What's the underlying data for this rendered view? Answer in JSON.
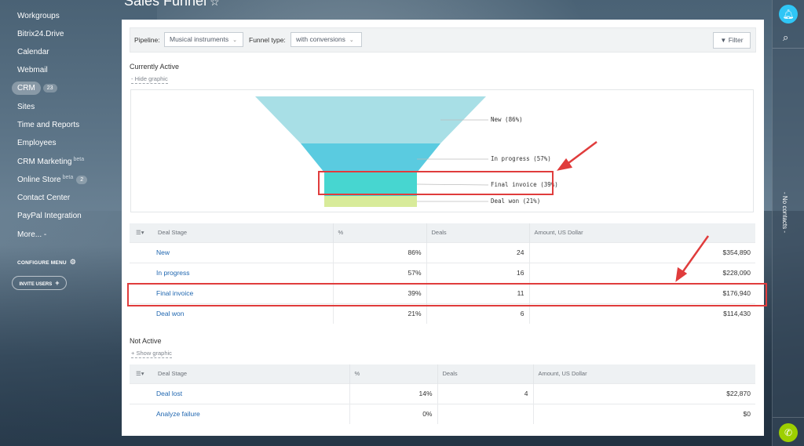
{
  "page": {
    "title": "Sales Funnel"
  },
  "sidebar": {
    "items": [
      {
        "label": "Workgroups"
      },
      {
        "label": "Bitrix24.Drive"
      },
      {
        "label": "Calendar"
      },
      {
        "label": "Webmail"
      },
      {
        "label": "CRM",
        "badge": "23"
      },
      {
        "label": "Sites"
      },
      {
        "label": "Time and Reports"
      },
      {
        "label": "Employees"
      },
      {
        "label": "CRM Marketing",
        "sup": "beta"
      },
      {
        "label": "Online Store",
        "sup": "beta",
        "badge": "2"
      },
      {
        "label": "Contact Center"
      },
      {
        "label": "PayPal Integration"
      },
      {
        "label": "More... -"
      }
    ],
    "configure_menu": "CONFIGURE MENU",
    "invite_users": "INVITE USERS"
  },
  "filterbar": {
    "pipeline_label": "Pipeline:",
    "pipeline_value": "Musical instruments",
    "funnel_type_label": "Funnel type:",
    "funnel_type_value": "with conversions",
    "filter_button": "Filter"
  },
  "active": {
    "title": "Currently Active",
    "toggle": "Hide graphic",
    "funnel": [
      {
        "label": "New (86%)",
        "color": "#a8dfe6"
      },
      {
        "label": "In progress (57%)",
        "color": "#5acbe0"
      },
      {
        "label": "Final invoice (39%)",
        "color": "#47d6d0"
      },
      {
        "label": "Deal won (21%)",
        "color": "#d8eb9a"
      }
    ],
    "headers": [
      "Deal Stage",
      "%",
      "Deals",
      "Amount, US Dollar"
    ],
    "rows": [
      {
        "stage": "New",
        "pct": "86%",
        "deals": "24",
        "amount": "$354,890"
      },
      {
        "stage": "In progress",
        "pct": "57%",
        "deals": "16",
        "amount": "$228,090"
      },
      {
        "stage": "Final invoice",
        "pct": "39%",
        "deals": "11",
        "amount": "$176,940"
      },
      {
        "stage": "Deal won",
        "pct": "21%",
        "deals": "6",
        "amount": "$114,430"
      }
    ]
  },
  "inactive": {
    "title": "Not Active",
    "toggle": "Show graphic",
    "headers": [
      "Deal Stage",
      "%",
      "Deals",
      "Amount, US Dollar"
    ],
    "rows": [
      {
        "stage": "Deal lost",
        "pct": "14%",
        "deals": "4",
        "amount": "$22,870"
      },
      {
        "stage": "Analyze failure",
        "pct": "0%",
        "deals": "",
        "amount": "$0"
      }
    ]
  },
  "rightbar": {
    "vertical_text": "- No contacts -"
  },
  "colors": {
    "annotation": "#e03c3c",
    "link": "#2067b0",
    "notification": "#2fc6f6",
    "phone": "#9dcf00"
  }
}
